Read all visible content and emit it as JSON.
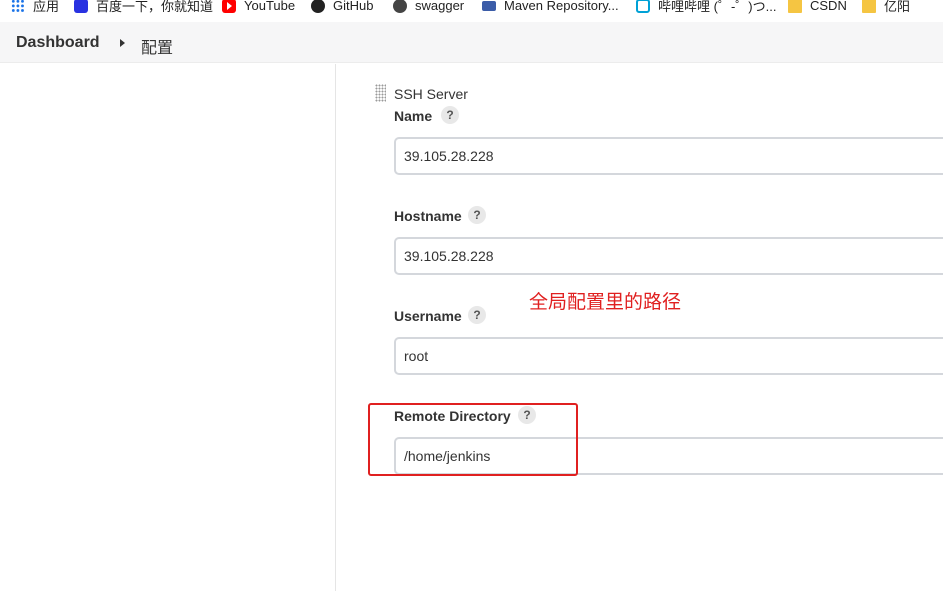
{
  "bookmarks": [
    {
      "icon": "apps-icon",
      "label": "应用"
    },
    {
      "icon": "baidu-icon",
      "label": "百度一下，你就知道"
    },
    {
      "icon": "youtube-icon",
      "label": "YouTube"
    },
    {
      "icon": "github-icon",
      "label": "GitHub"
    },
    {
      "icon": "globe-icon",
      "label": "swagger"
    },
    {
      "icon": "maven-icon",
      "label": "Maven Repository..."
    },
    {
      "icon": "bilibili-icon",
      "label": "哔哩哔哩 (゜-゜)つ..."
    },
    {
      "icon": "folder-icon",
      "label": "CSDN"
    },
    {
      "icon": "folder-icon",
      "label": "亿阳"
    }
  ],
  "breadcrumb": {
    "root": "Dashboard",
    "current": "配置"
  },
  "ssh_server": {
    "section_title": "SSH Server",
    "help_glyph": "?",
    "fields": {
      "name": {
        "label": "Name",
        "value": "39.105.28.228"
      },
      "hostname": {
        "label": "Hostname",
        "value": "39.105.28.228"
      },
      "username": {
        "label": "Username",
        "value": "root"
      },
      "remote_directory": {
        "label": "Remote Directory",
        "value": "/home/jenkins"
      }
    }
  },
  "annotation": {
    "text": "全局配置里的路径",
    "color": "#e02020"
  }
}
